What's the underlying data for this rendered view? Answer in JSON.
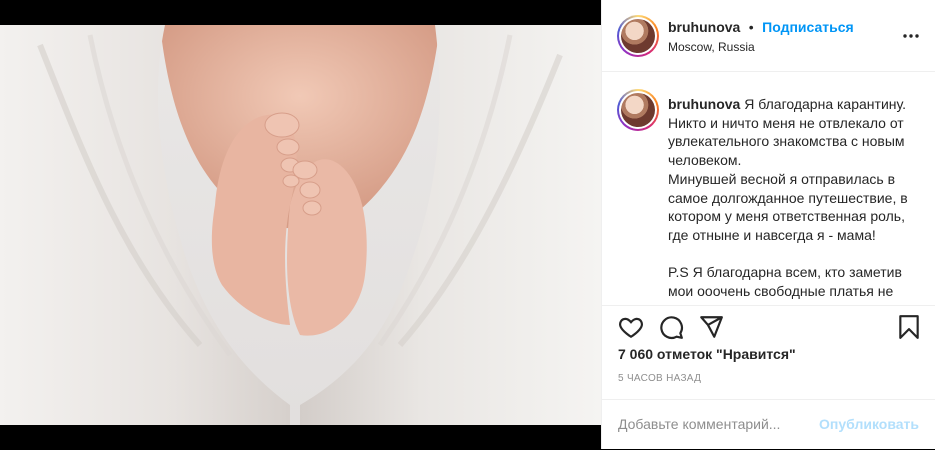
{
  "post": {
    "author": {
      "username": "bruhunova",
      "separator": "•",
      "follow_label": "Подписаться",
      "location": "Moscow, Russia"
    },
    "caption": {
      "username": "bruhunova",
      "text": " Я благодарна карантину. Никто и ничто меня не отвлекало от увлекательного знакомства с новым человеком.\nМинувшей весной я отправилась в самое долгожданное путешествие, в котором у меня ответственная роль, где отныне и навсегда я - мама!\n\nP.S Я благодарна всем, кто заметив мои ооочень свободные платья не"
    },
    "likes_text": "7 060 отметок \"Нравится\"",
    "time_text": "5 часов назад",
    "comment": {
      "placeholder": "Добавьте комментарий...",
      "publish_label": "Опубликовать"
    },
    "icons": {
      "more": "more-horizontal-icon",
      "like": "heart-icon",
      "comment": "comment-icon",
      "share": "paper-plane-icon",
      "save": "bookmark-icon"
    },
    "colors": {
      "link_blue": "#0095f6",
      "publish_disabled": "#b2dffc",
      "muted": "#8e8e8e"
    }
  }
}
